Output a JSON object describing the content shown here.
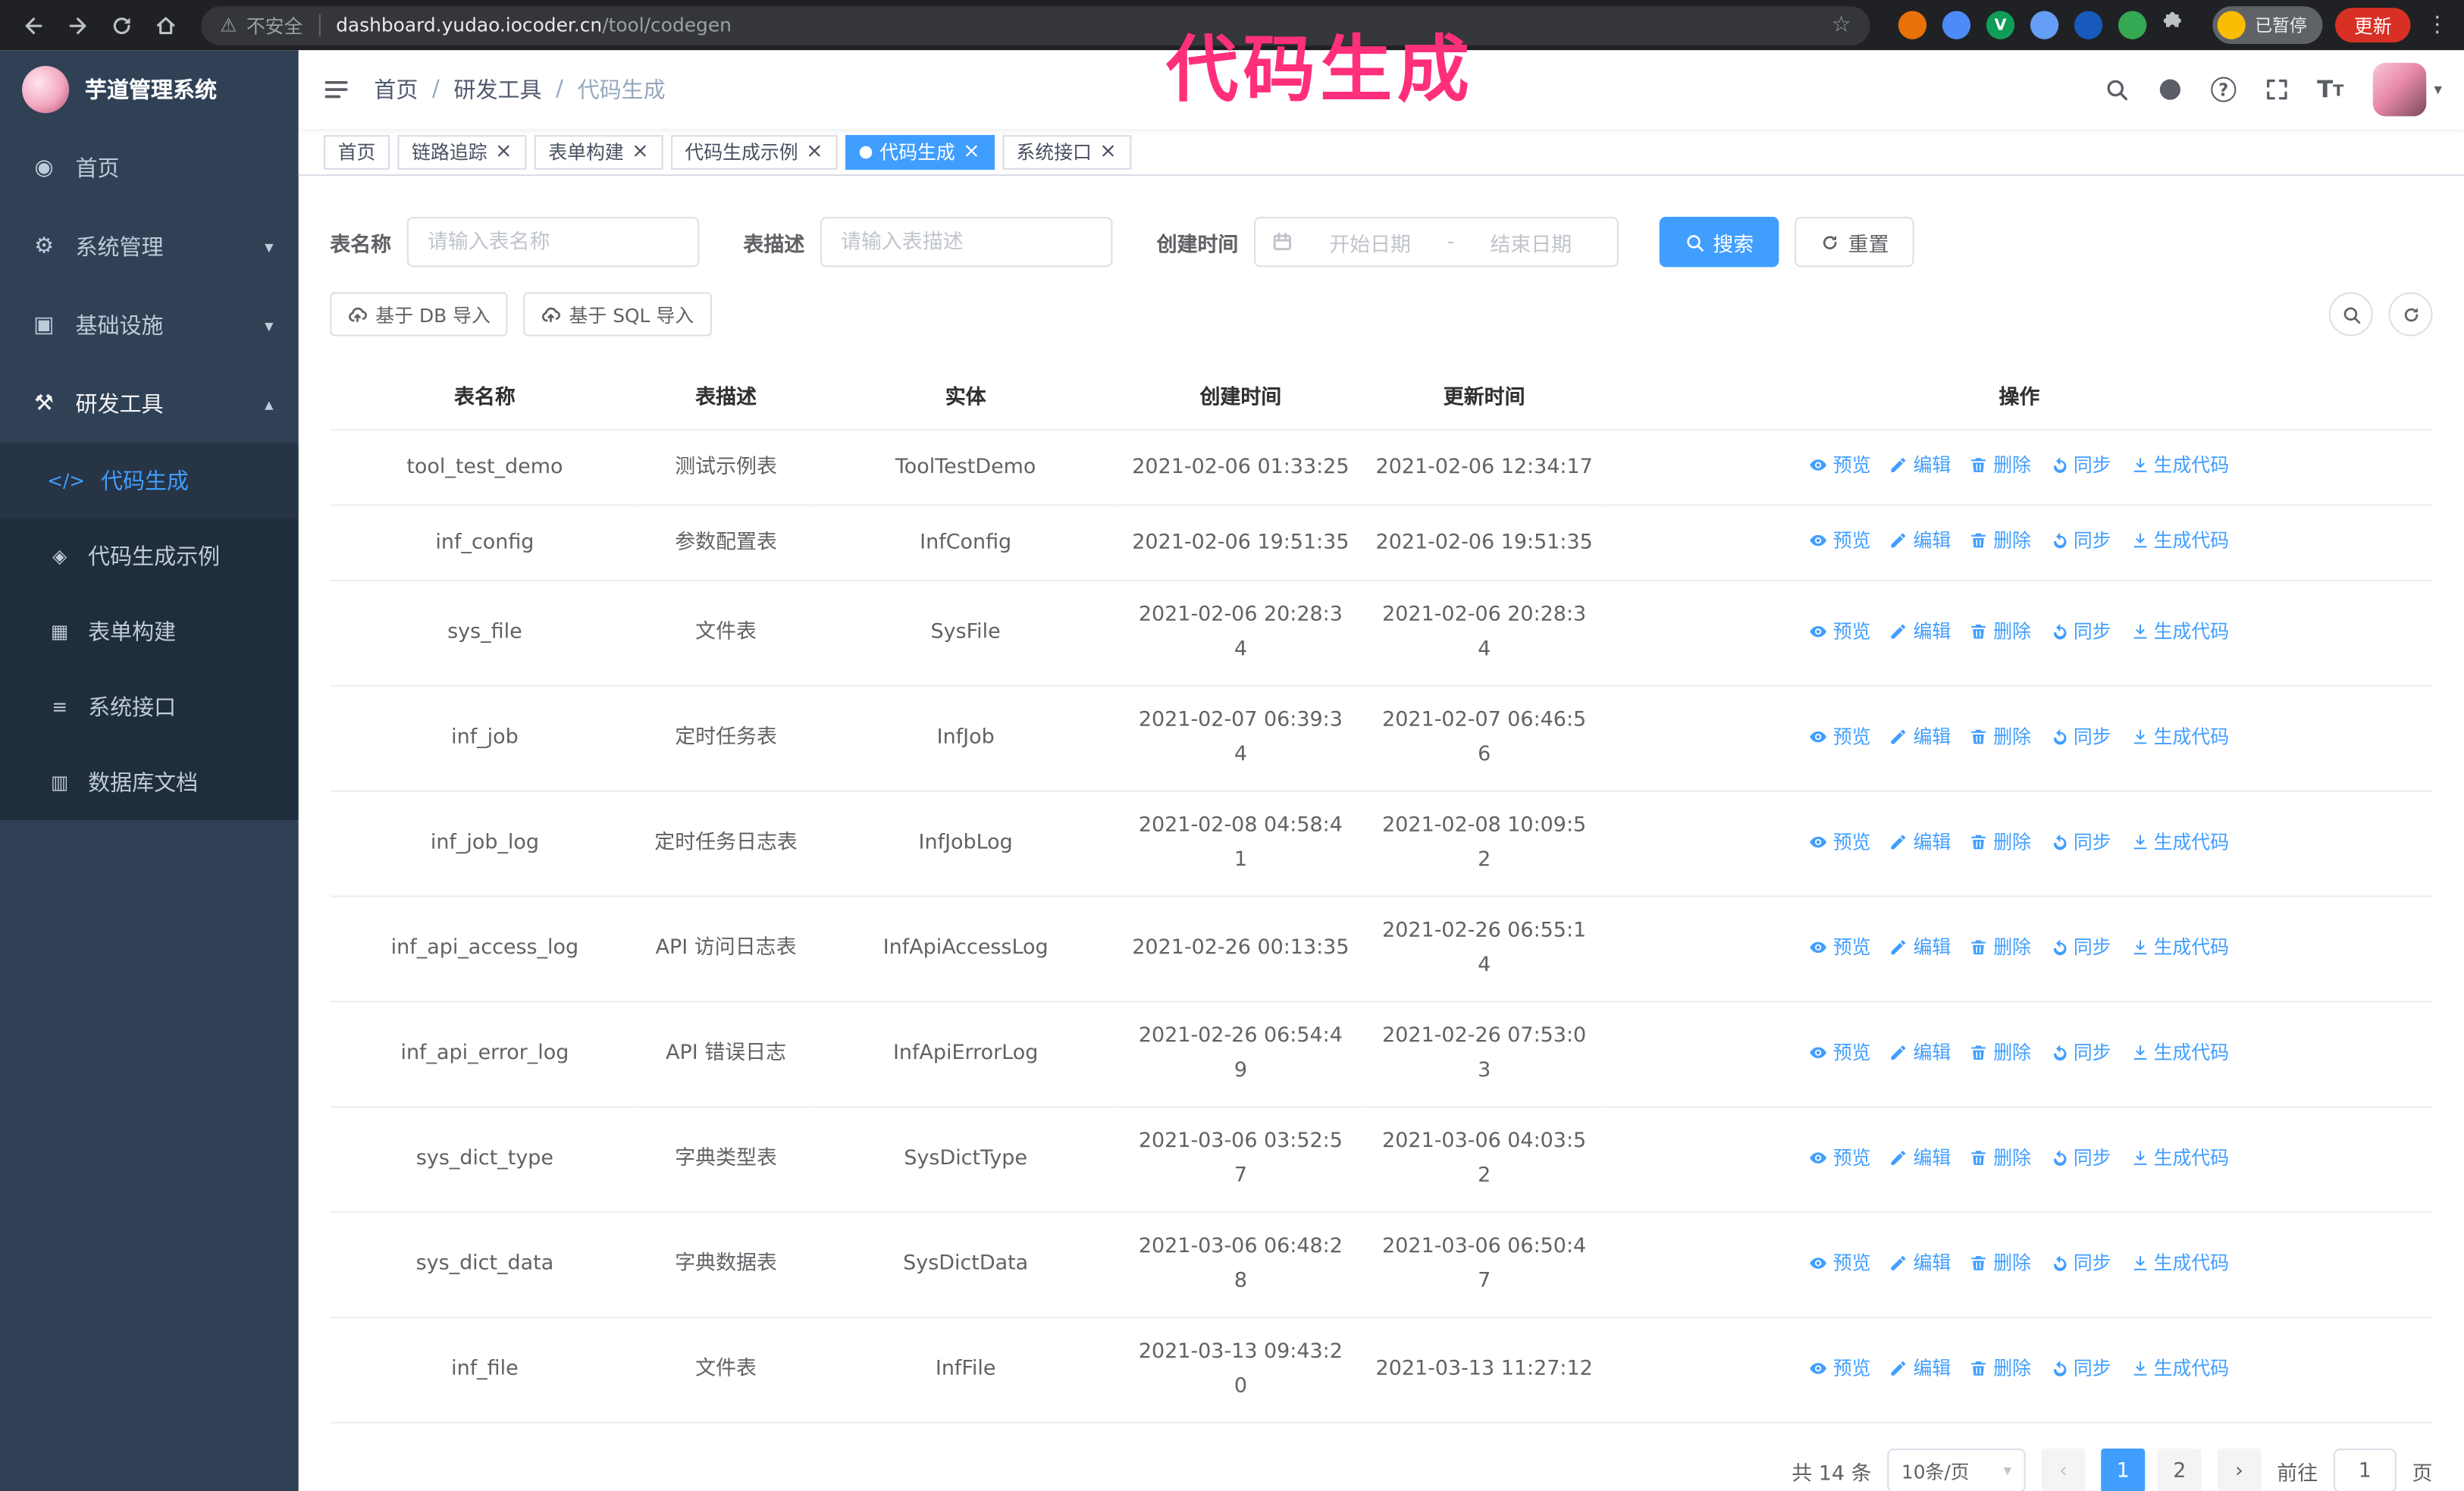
{
  "annotation": {
    "text": "代码生成"
  },
  "colors": {
    "accent": "#409EFF",
    "sidebar_bg": "#304156",
    "submenu_bg": "#1f2d3d",
    "submenu_active_bg": "#263445",
    "annotation": "#ff2f7b",
    "update_red": "#d93025",
    "chrome_bg": "#202124",
    "omnibox_bg": "#35363a"
  },
  "icons": {
    "close_icon": "×",
    "warning_icon": "⚠",
    "star_icon": "☆",
    "kebab_icon": "⋮",
    "caret_down_icon": "▾",
    "caret_up_icon": "▴",
    "question_icon": "?",
    "fontsize_icon": "T",
    "extension_letter": "V",
    "dashboard_icon": "◉",
    "gear_icon": "⚙",
    "infra_icon": "▣",
    "tools_icon": "⚒",
    "code_icon": "</>",
    "example_icon": "◈",
    "form_icon": "▦",
    "api_icon": "≡",
    "db_icon": "▥",
    "prev_icon": "‹",
    "next_icon": "›"
  },
  "browser": {
    "security_label": "不安全",
    "url_domain": "dashboard.yudao.iocoder.cn",
    "url_path": "/tool/codegen",
    "profile_label": "已暂停",
    "update_label": "更新",
    "extension_colors": [
      "#e8710a",
      "#4c8bf5",
      "#0f9d58",
      "#669df6",
      "#185abc",
      "#34a853"
    ]
  },
  "sidebar": {
    "logo_title": "芋道管理系统",
    "items": [
      {
        "label": "首页"
      },
      {
        "label": "系统管理"
      },
      {
        "label": "基础设施"
      },
      {
        "label": "研发工具"
      }
    ],
    "submenu": [
      {
        "label": "代码生成"
      },
      {
        "label": "代码生成示例"
      },
      {
        "label": "表单构建"
      },
      {
        "label": "系统接口"
      },
      {
        "label": "数据库文档"
      }
    ]
  },
  "navbar": {
    "breadcrumb": [
      "首页",
      "研发工具",
      "代码生成"
    ],
    "separator": "/"
  },
  "tags": [
    {
      "label": "首页",
      "closable": false,
      "active": false
    },
    {
      "label": "链路追踪",
      "closable": true,
      "active": false
    },
    {
      "label": "表单构建",
      "closable": true,
      "active": false
    },
    {
      "label": "代码生成示例",
      "closable": true,
      "active": false
    },
    {
      "label": "代码生成",
      "closable": true,
      "active": true
    },
    {
      "label": "系统接口",
      "closable": true,
      "active": false
    }
  ],
  "search": {
    "table_name_label": "表名称",
    "table_name_placeholder": "请输入表名称",
    "table_desc_label": "表描述",
    "table_desc_placeholder": "请输入表描述",
    "create_time_label": "创建时间",
    "date_start_placeholder": "开始日期",
    "date_separator": "-",
    "date_end_placeholder": "结束日期",
    "search_label": "搜索",
    "reset_label": "重置"
  },
  "toolbar": {
    "import_db_label": "基于 DB 导入",
    "import_sql_label": "基于 SQL 导入"
  },
  "table": {
    "columns": [
      "表名称",
      "表描述",
      "实体",
      "创建时间",
      "更新时间",
      "操作"
    ],
    "action_labels": [
      "预览",
      "编辑",
      "删除",
      "同步",
      "生成代码"
    ],
    "rows": [
      {
        "name": "tool_test_demo",
        "desc": "测试示例表",
        "entity": "ToolTestDemo",
        "created": "2021-02-06 01:33:25",
        "updated": "2021-02-06 12:34:17"
      },
      {
        "name": "inf_config",
        "desc": "参数配置表",
        "entity": "InfConfig",
        "created": "2021-02-06 19:51:35",
        "updated": "2021-02-06 19:51:35"
      },
      {
        "name": "sys_file",
        "desc": "文件表",
        "entity": "SysFile",
        "created": "2021-02-06 20:28:3\n4",
        "updated": "2021-02-06 20:28:3\n4"
      },
      {
        "name": "inf_job",
        "desc": "定时任务表",
        "entity": "InfJob",
        "created": "2021-02-07 06:39:3\n4",
        "updated": "2021-02-07 06:46:5\n6"
      },
      {
        "name": "inf_job_log",
        "desc": "定时任务日志表",
        "entity": "InfJobLog",
        "created": "2021-02-08 04:58:4\n1",
        "updated": "2021-02-08 10:09:5\n2"
      },
      {
        "name": "inf_api_access_log",
        "desc": "API 访问日志表",
        "entity": "InfApiAccessLog",
        "created": "2021-02-26 00:13:35",
        "updated": "2021-02-26 06:55:1\n4"
      },
      {
        "name": "inf_api_error_log",
        "desc": "API 错误日志",
        "entity": "InfApiErrorLog",
        "created": "2021-02-26 06:54:4\n9",
        "updated": "2021-02-26 07:53:0\n3"
      },
      {
        "name": "sys_dict_type",
        "desc": "字典类型表",
        "entity": "SysDictType",
        "created": "2021-03-06 03:52:5\n7",
        "updated": "2021-03-06 04:03:5\n2"
      },
      {
        "name": "sys_dict_data",
        "desc": "字典数据表",
        "entity": "SysDictData",
        "created": "2021-03-06 06:48:2\n8",
        "updated": "2021-03-06 06:50:4\n7"
      },
      {
        "name": "inf_file",
        "desc": "文件表",
        "entity": "InfFile",
        "created": "2021-03-13 09:43:2\n0",
        "updated": "2021-03-13 11:27:12"
      }
    ]
  },
  "pagination": {
    "total_label": "共 14 条",
    "page_size_label": "10条/页",
    "pages": [
      "1",
      "2"
    ],
    "active_page": "1",
    "goto_label": "前往",
    "goto_value": "1",
    "page_suffix": "页"
  }
}
